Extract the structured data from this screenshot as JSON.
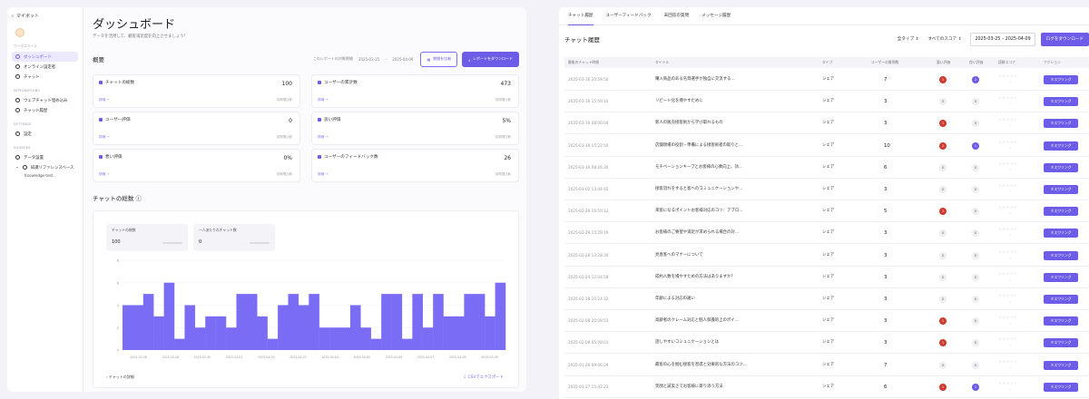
{
  "sidebar": {
    "back_label": "マイボット",
    "section_top": "ワークスペース",
    "items_top": [
      {
        "label": "ダッシュボード",
        "active": true
      },
      {
        "label": "オンライン設定者",
        "active": false
      },
      {
        "label": "チャット",
        "active": false
      }
    ],
    "section_integrations": "INTEGRATIONS",
    "items_integrations": [
      {
        "label": "ウェブチャット埋め込み"
      },
      {
        "label": "チャット履歴"
      }
    ],
    "section_settings": "SETTINGS",
    "items_settings": [
      {
        "label": "設定"
      }
    ],
    "section_sources": "SOURCES",
    "items_sources": [
      {
        "label": "データ設置"
      },
      {
        "label": "知識リファレンスベース"
      }
    ],
    "sub_item": "Knowledge-test..."
  },
  "main": {
    "title": "ダッシュボード",
    "subtitle": "データを活用して、顧客満足度を向上させましょう！",
    "overview_title": "概要",
    "period_label": "このレポートの対象期間",
    "period_start": "2025-03-25",
    "period_end": "2025-04-09",
    "compare_button": "期間を比較",
    "download_button": "レポートをダウンロード",
    "metrics": [
      {
        "label": "チャットの総数",
        "value": "100",
        "link": "詳細 →",
        "caption": "前期間比較"
      },
      {
        "label": "ユーザーの累計数",
        "value": "473",
        "link": "詳細 →",
        "caption": "前期間比較"
      },
      {
        "label": "ユーザー評価",
        "value": "0",
        "link": "詳細 →",
        "caption": "前期間比較"
      },
      {
        "label": "良い評価",
        "value": "5%",
        "link": "詳細 →",
        "caption": "前期間比較"
      },
      {
        "label": "悪い評価",
        "value": "0%",
        "link": "詳細 →",
        "caption": "前期間比較"
      },
      {
        "label": "ユーザーのフィードバック数",
        "value": "26",
        "link": "詳細 →",
        "caption": "前期間比較"
      }
    ],
    "chat_section_title": "チャットの総数",
    "stats": [
      {
        "label": "チャットの総数",
        "value": "100"
      },
      {
        "label": "一人あたりのチャット数",
        "value": "0"
      }
    ],
    "chart_footer": "チャットの詳細",
    "chart_link": "CSVでエクスポート"
  },
  "chart_data": {
    "type": "bar",
    "title": "",
    "xlabel": "",
    "ylabel": "",
    "ylim": [
      0,
      8
    ],
    "yticks": [
      "0",
      "2",
      "4",
      "6",
      "8"
    ],
    "xtick_labels": [
      "2025-03-26",
      "2025-03-28",
      "2025-03-30",
      "2025-04-01",
      "2025-04-02",
      "2025-04-03",
      "2025-04-04",
      "2025-04-05",
      "2025-04-06",
      "2025-04-07",
      "2025-04-08",
      "2025-04-09"
    ],
    "values": [
      4,
      4,
      5,
      3,
      6,
      1,
      4,
      2,
      3,
      3,
      2,
      5,
      5,
      3,
      1,
      4,
      5,
      4,
      5,
      2,
      2,
      2,
      4,
      2,
      1,
      5,
      5,
      1,
      5,
      2,
      5,
      3,
      3,
      5,
      5,
      3,
      6
    ],
    "color": "#7b6cf6"
  },
  "right": {
    "tabs": [
      "チャット履歴",
      "ユーザーフィードバック",
      "未回答の質問",
      "メッセージ履歴"
    ],
    "title": "チャット履歴",
    "filter_type": "全タイプ",
    "filter_score": "すべてのスコア",
    "date_range": "2025-03-25 – 2025-04-09",
    "download": "ログをダウンロード",
    "headers": [
      "最後のチャット時間",
      "タイトル",
      "タイプ",
      "ユーザーの質問数",
      "悪い評価",
      "良い評価",
      "読解スコア",
      "アクション"
    ],
    "feedback_button": "ミスワリング",
    "rows": [
      {
        "date": "2025-03-16 20:59:50",
        "title": "購入商品のある名目選手が独自に交流する...",
        "type": "シェア",
        "count": "7",
        "bad": "1",
        "good": "2",
        "bad_red": true,
        "good_purple": true
      },
      {
        "date": "2025-03-16 15:59:10",
        "title": "リピート化を増やすために",
        "type": "シェア",
        "count": "3",
        "bad": "0",
        "good": "0",
        "bad_red": false,
        "good_purple": false
      },
      {
        "date": "2025-03-16 08:00:04",
        "title": "新人の販売接客術から学び取れるもの",
        "type": "シェア",
        "count": "3",
        "bad": "1",
        "good": "0",
        "bad_red": true,
        "good_purple": false
      },
      {
        "date": "2025-03-16 15:22:50",
        "title": "店舗現場の役割・準備による接客術者の取りと...",
        "type": "シェア",
        "count": "10",
        "bad": "2",
        "good": "1",
        "bad_red": true,
        "good_purple": true
      },
      {
        "date": "2025-03-16 08:26:30",
        "title": "モチベーションキープとお客様の心象向上、効...",
        "type": "シェア",
        "count": "6",
        "bad": "0",
        "good": "0",
        "bad_red": false,
        "good_purple": false
      },
      {
        "date": "2025-03-02 13:04:45",
        "title": "接客流れをすると客へのコミュニケーションや...",
        "type": "シェア",
        "count": "3",
        "bad": "0",
        "good": "0",
        "bad_red": false,
        "good_purple": false
      },
      {
        "date": "2025-02-28 16:50:12",
        "title": "来客になるポイントお客様対応のコツ：アプロ...",
        "type": "シェア",
        "count": "5",
        "bad": "1",
        "good": "0",
        "bad_red": true,
        "good_purple": false
      },
      {
        "date": "2025-02-28 15:29:19",
        "title": "お客様のご要望や満足が求められる場合の対...",
        "type": "シェア",
        "count": "3",
        "bad": "0",
        "good": "0",
        "bad_red": false,
        "good_purple": false
      },
      {
        "date": "2025-02-28 13:28:30",
        "title": "見直客へのマナーについて",
        "type": "シェア",
        "count": "3",
        "bad": "0",
        "good": "0",
        "bad_red": false,
        "good_purple": false
      },
      {
        "date": "2025-02-24 12:04:58",
        "title": "成約人数を増やすための方法はありますか？",
        "type": "シェア",
        "count": "3",
        "bad": "0",
        "good": "0",
        "bad_red": false,
        "good_purple": false
      },
      {
        "date": "2025-02-18 10:24:32",
        "title": "年齢による対応の違い",
        "type": "シェア",
        "count": "3",
        "bad": "0",
        "good": "0",
        "bad_red": false,
        "good_purple": false
      },
      {
        "date": "2025-02-08 20:09:53",
        "title": "高齢者のクレーム対応と個人保護的上のポイ...",
        "type": "シェア",
        "count": "3",
        "bad": "1",
        "good": "0",
        "bad_red": true,
        "good_purple": false
      },
      {
        "date": "2025-02-08 05:08:01",
        "title": "話しやすいコミュニケーションとは",
        "type": "シェア",
        "count": "3",
        "bad": "1",
        "good": "0",
        "bad_red": true,
        "good_purple": false
      },
      {
        "date": "2025-01-26 09:46:29",
        "title": "最客の心を掴む接客を習得と効果的な方法のコツ...",
        "type": "シェア",
        "count": "7",
        "bad": "0",
        "good": "0",
        "bad_red": false,
        "good_purple": false
      },
      {
        "date": "2025-01-27 15:42:23",
        "title": "笑顔と誠実さでお客様に寄り添う方法",
        "type": "シェア",
        "count": "6",
        "bad": "1",
        "good": "1",
        "bad_red": true,
        "good_purple": true
      }
    ]
  }
}
